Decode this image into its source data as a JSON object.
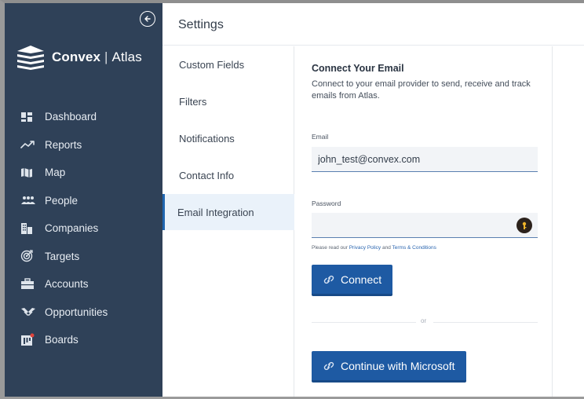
{
  "app": {
    "brand": "Convex",
    "separator": "|",
    "product": "Atlas"
  },
  "sidebar": {
    "items": [
      {
        "label": "Dashboard",
        "icon": "dashboard-icon"
      },
      {
        "label": "Reports",
        "icon": "reports-icon"
      },
      {
        "label": "Map",
        "icon": "map-icon"
      },
      {
        "label": "People",
        "icon": "people-icon"
      },
      {
        "label": "Companies",
        "icon": "companies-icon"
      },
      {
        "label": "Targets",
        "icon": "targets-icon"
      },
      {
        "label": "Accounts",
        "icon": "accounts-icon"
      },
      {
        "label": "Opportunities",
        "icon": "opportunities-icon"
      },
      {
        "label": "Boards",
        "icon": "boards-icon"
      }
    ]
  },
  "header": {
    "title": "Settings"
  },
  "settings_menu": {
    "items": [
      {
        "label": "Custom Fields",
        "active": false
      },
      {
        "label": "Filters",
        "active": false
      },
      {
        "label": "Notifications",
        "active": false
      },
      {
        "label": "Contact Info",
        "active": false
      },
      {
        "label": "Email Integration",
        "active": true
      }
    ]
  },
  "email_panel": {
    "title": "Connect Your Email",
    "description": "Connect to your email provider to send, receive and track emails from Atlas.",
    "email_label": "Email",
    "email_value": "john_test@convex.com",
    "password_label": "Password",
    "password_value": "",
    "hint_prefix": "Please read our ",
    "privacy_link": "Privacy Policy",
    "hint_and": " and ",
    "terms_link": "Terms & Conditions",
    "connect_label": "Connect",
    "or_label": "or",
    "microsoft_label": "Continue with Microsoft"
  },
  "colors": {
    "sidebar_bg": "#2f4158",
    "accent": "#1e5aa3",
    "active_menu_bg": "#eaf2fa",
    "input_bg": "#f2f4f7"
  }
}
